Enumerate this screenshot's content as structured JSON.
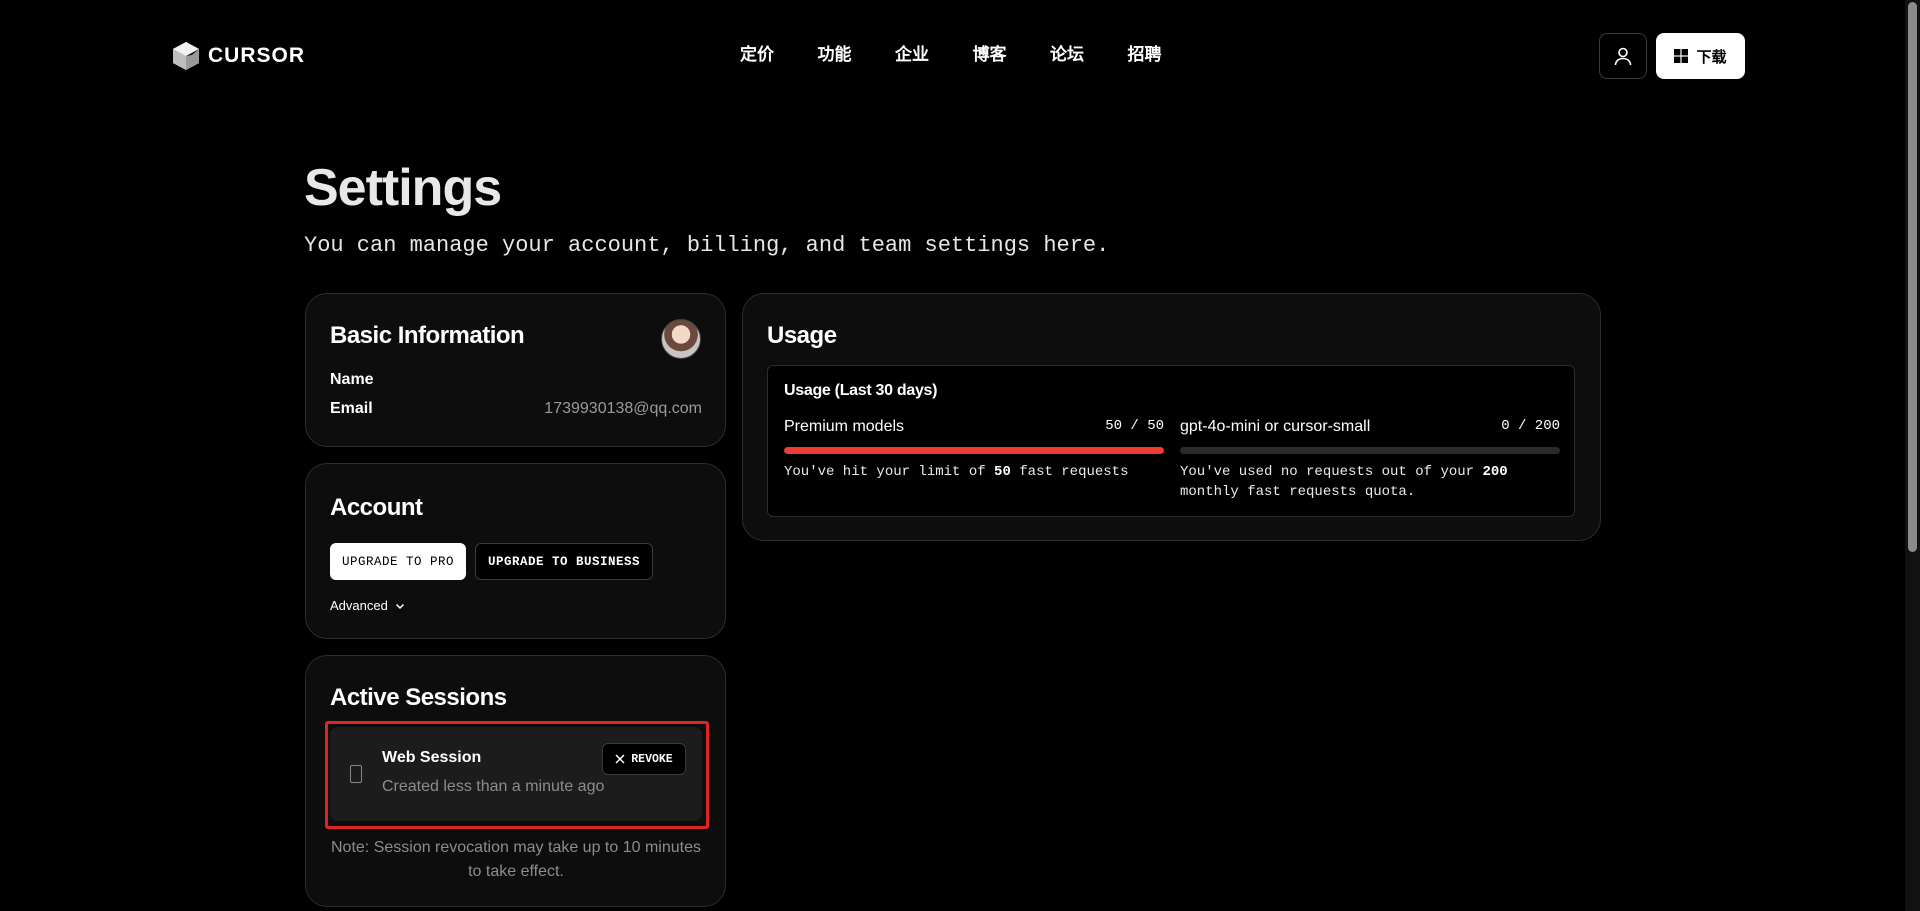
{
  "header": {
    "logo_text": "CURSOR",
    "nav": [
      "定价",
      "功能",
      "企业",
      "博客",
      "论坛",
      "招聘"
    ],
    "download_label": "下载"
  },
  "page": {
    "title": "Settings",
    "subtitle": "You can manage your account, billing, and team settings here."
  },
  "basic_info": {
    "title": "Basic Information",
    "name_label": "Name",
    "name_value": "",
    "email_label": "Email",
    "email_value": "1739930138@qq.com"
  },
  "account": {
    "title": "Account",
    "upgrade_pro_label": "UPGRADE TO PRO",
    "upgrade_business_label": "UPGRADE TO BUSINESS",
    "advanced_label": "Advanced"
  },
  "sessions": {
    "title": "Active Sessions",
    "items": [
      {
        "name": "Web Session",
        "created": "Created less than a minute ago",
        "revoke_label": "REVOKE"
      }
    ],
    "note": "Note: Session revocation may take up to 10 minutes to take effect."
  },
  "usage": {
    "title": "Usage",
    "heading": "Usage (Last 30 days)",
    "premium": {
      "label": "Premium models",
      "count": "50 / 50",
      "used": 50,
      "limit": 50,
      "desc_prefix": "You've hit your limit of ",
      "desc_number": "50",
      "desc_suffix": " fast requests"
    },
    "small": {
      "label": "gpt-4o-mini or cursor-small",
      "count": "0 / 200",
      "used": 0,
      "limit": 200,
      "desc_prefix": "You've used no requests out of your ",
      "desc_number": "200",
      "desc_suffix": " monthly fast requests quota."
    }
  },
  "colors": {
    "accent_red": "#ef3b32",
    "highlight_red": "#e02424"
  }
}
